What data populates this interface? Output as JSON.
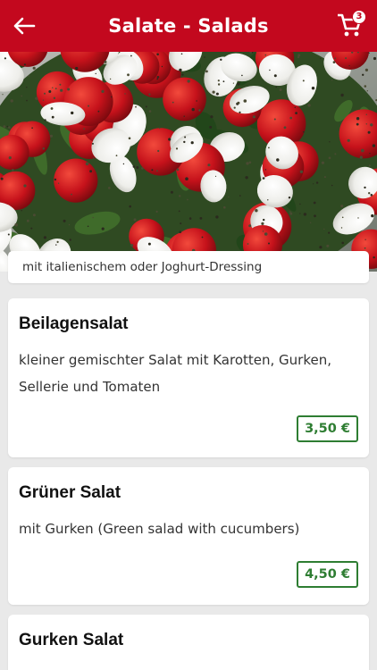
{
  "header": {
    "title": "Salate - Salads",
    "cart_count": "3",
    "colors": {
      "bar": "#c3081e",
      "text": "#ffffff"
    },
    "icons": {
      "back": "arrow-left-icon",
      "cart": "shopping-cart-icon"
    }
  },
  "category": {
    "image": "caprese-salad-photo",
    "caption": "mit italienischem oder Joghurt-Dressing"
  },
  "items": [
    {
      "name": "Beilagensalat",
      "description": "kleiner gemischter Salat mit Karotten, Gurken, Sellerie und Tomaten",
      "price": "3,50 €"
    },
    {
      "name": "Grüner Salat",
      "description": "mit Gurken (Green salad with cucumbers)",
      "price": "4,50 €"
    },
    {
      "name": "Gurken Salat"
    }
  ],
  "price_color": "#2e7d32"
}
